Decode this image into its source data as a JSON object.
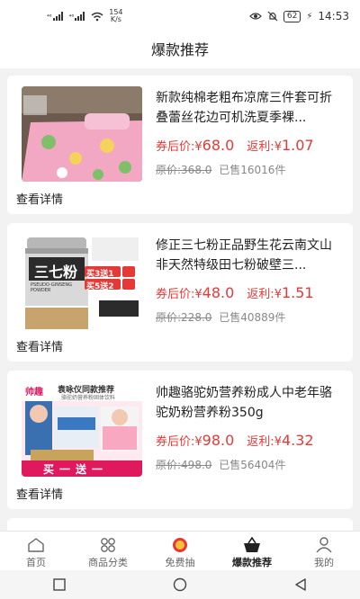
{
  "status_bar": {
    "signal_1": "⁴⁶",
    "signal_2": "⁴⁶",
    "speed_value": "154",
    "speed_unit": "K/s",
    "battery": "62",
    "time": "14:53"
  },
  "header": {
    "title": "爆款推荐"
  },
  "products": [
    {
      "title": "新款纯棉老粗布凉席三件套可折叠蕾丝花边可机洗夏季裸...",
      "coupon_label": "券后价:",
      "currency": "¥",
      "price": "68.0",
      "rebate_label": "返利:",
      "rebate": "1.07",
      "orig_label": "原价:",
      "orig_price": "368.0",
      "sold": "已售16016件",
      "detail_label": "查看详情"
    },
    {
      "title": "修正三七粉正品野生花云南文山非天然特级田七粉破壁三...",
      "coupon_label": "券后价:",
      "currency": "¥",
      "price": "48.0",
      "rebate_label": "返利:",
      "rebate": "1.51",
      "orig_label": "原价:",
      "orig_price": "228.0",
      "sold": "已售40889件",
      "detail_label": "查看详情",
      "image_text": {
        "jar_label": "三七粉",
        "jar_sub": "PSEUDO-GINSENG POWDER",
        "promo1": "买3送1",
        "promo2": "买5送2"
      }
    },
    {
      "title": "帅趣骆驼奶营养粉成人中老年骆驼奶粉营养粉350g",
      "coupon_label": "券后价:",
      "currency": "¥",
      "price": "98.0",
      "rebate_label": "返利:",
      "rebate": "4.32",
      "orig_label": "原价:",
      "orig_price": "498.0",
      "sold": "已售56404件",
      "detail_label": "查看详情",
      "image_text": {
        "brand": "帅趣",
        "slogan": "袁咏仪同款推荐",
        "sub": "骆驼奶营养粉固体饮料",
        "bottom": "买一送一"
      }
    }
  ],
  "tabs": [
    {
      "label": "首页",
      "icon": "home-icon"
    },
    {
      "label": "商品分类",
      "icon": "category-icon"
    },
    {
      "label": "免费抽",
      "icon": "lottery-icon"
    },
    {
      "label": "爆款推荐",
      "icon": "basket-icon"
    },
    {
      "label": "我的",
      "icon": "user-icon"
    }
  ],
  "colors": {
    "accent": "#e53935",
    "text": "#222222",
    "muted": "#888888"
  }
}
